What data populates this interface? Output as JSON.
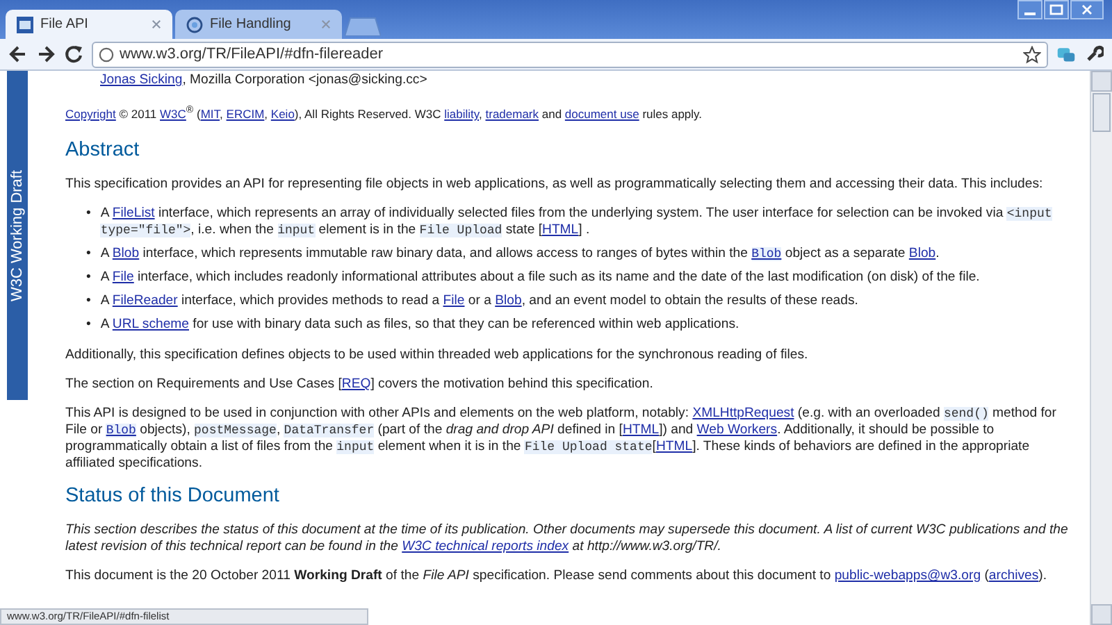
{
  "browser": {
    "tabs": [
      {
        "title": "File API",
        "selected": true
      },
      {
        "title": "File Handling",
        "selected": false
      }
    ],
    "address": "www.w3.org/TR/FileAPI/#dfn-filereader"
  },
  "sidebar_badge": "W3C Working Draft",
  "document": {
    "blocks": [
      {
        "kind": "editor",
        "segments": [
          {
            "kind": "link",
            "text": "Jonas Sicking"
          },
          {
            "kind": "text",
            "text": ", Mozilla Corporation <jonas@sicking.cc>"
          }
        ]
      },
      {
        "kind": "note",
        "segments": [
          {
            "kind": "link",
            "text": "Copyright"
          },
          {
            "kind": "text",
            "text": " © 2011 "
          },
          {
            "kind": "link",
            "text": "W3C"
          },
          {
            "kind": "text",
            "text": "$^{®}$ ("
          },
          {
            "kind": "link",
            "text": "MIT"
          },
          {
            "kind": "text",
            "text": ", "
          },
          {
            "kind": "link",
            "text": "ERCIM"
          },
          {
            "kind": "text",
            "text": ", "
          },
          {
            "kind": "link",
            "text": "Keio"
          },
          {
            "kind": "text",
            "text": "), All Rights Reserved. W3C "
          },
          {
            "kind": "link",
            "text": "liability"
          },
          {
            "kind": "text",
            "text": ", "
          },
          {
            "kind": "link",
            "text": "trademark"
          },
          {
            "kind": "text",
            "text": " and "
          },
          {
            "kind": "link",
            "text": "document use"
          },
          {
            "kind": "text",
            "text": " rules apply."
          }
        ]
      },
      {
        "kind": "heading",
        "text": "Abstract"
      },
      {
        "kind": "para",
        "segments": [
          {
            "kind": "text",
            "text": "This specification provides an API for representing file objects in web applications, as well as programmatically selecting them and accessing their data. This includes:"
          }
        ]
      },
      {
        "kind": "list",
        "items": [
          {
            "marker": "•",
            "segments": [
              {
                "kind": "text",
                "text": "A "
              },
              {
                "kind": "link",
                "text": "FileList"
              },
              {
                "kind": "text",
                "text": " interface, which represents an array of individually selected files from the underlying system. The user interface for selection can be invoked via "
              },
              {
                "kind": "code",
                "text": "<input type=\"file\">"
              },
              {
                "kind": "text",
                "text": ", i.e. when the "
              },
              {
                "kind": "code",
                "text": "input"
              },
              {
                "kind": "text",
                "text": " element is in the "
              },
              {
                "kind": "code",
                "text": "File Upload"
              },
              {
                "kind": "text",
                "text": " state ["
              },
              {
                "kind": "link",
                "text": "HTML"
              },
              {
                "kind": "text",
                "text": "] ."
              }
            ]
          },
          {
            "marker": "•",
            "segments": [
              {
                "kind": "text",
                "text": "A "
              },
              {
                "kind": "link",
                "text": "Blob"
              },
              {
                "kind": "text",
                "text": " interface, which represents immutable raw binary data, and allows access to ranges of bytes within the "
              },
              {
                "kind": "code_link",
                "text": "Blob"
              },
              {
                "kind": "text",
                "text": " object as a separate "
              },
              {
                "kind": "link",
                "text": "Blob"
              },
              {
                "kind": "text",
                "text": "."
              }
            ]
          },
          {
            "marker": "•",
            "segments": [
              {
                "kind": "text",
                "text": "A "
              },
              {
                "kind": "link",
                "text": "File"
              },
              {
                "kind": "text",
                "text": " interface, which includes readonly informational attributes about a file such as its name and the date of the last modification (on disk) of the file."
              }
            ]
          },
          {
            "marker": "•",
            "segments": [
              {
                "kind": "text",
                "text": "A "
              },
              {
                "kind": "link",
                "text": "FileReader"
              },
              {
                "kind": "text",
                "text": " interface, which provides methods to read a "
              },
              {
                "kind": "link",
                "text": "File"
              },
              {
                "kind": "text",
                "text": " or a "
              },
              {
                "kind": "link",
                "text": "Blob"
              },
              {
                "kind": "text",
                "text": ", and an event model to obtain the results of these reads."
              }
            ]
          },
          {
            "marker": "•",
            "segments": [
              {
                "kind": "text",
                "text": "A "
              },
              {
                "kind": "link",
                "text": "URL scheme"
              },
              {
                "kind": "text",
                "text": " for use with binary data such as files, so that they can be referenced within web applications."
              }
            ]
          }
        ]
      },
      {
        "kind": "para",
        "segments": [
          {
            "kind": "text",
            "text": "Additionally, this specification defines objects to be used within threaded web applications for the synchronous reading of files."
          }
        ]
      },
      {
        "kind": "para",
        "segments": [
          {
            "kind": "text",
            "text": "The section on Requirements and Use Cases ["
          },
          {
            "kind": "link",
            "text": "REQ"
          },
          {
            "kind": "text",
            "text": "] covers the motivation behind this specification."
          }
        ]
      },
      {
        "kind": "para",
        "segments": [
          {
            "kind": "text",
            "text": "This API is designed to be used in conjunction with other APIs and elements on the web platform, notably: "
          },
          {
            "kind": "link",
            "text": "XMLHttpRequest"
          },
          {
            "kind": "text",
            "text": " (e.g. with an overloaded "
          },
          {
            "kind": "code",
            "text": "send()"
          },
          {
            "kind": "text",
            "text": " method for File or "
          },
          {
            "kind": "code_link",
            "text": "Blob"
          },
          {
            "kind": "text",
            "text": " objects), "
          },
          {
            "kind": "code",
            "text": "postMessage"
          },
          {
            "kind": "text",
            "text": ", "
          },
          {
            "kind": "code",
            "text": "DataTransfer"
          },
          {
            "kind": "text",
            "text": " (part of the *drag and drop API* defined in ["
          },
          {
            "kind": "link",
            "text": "HTML"
          },
          {
            "kind": "text",
            "text": "]) and "
          },
          {
            "kind": "link",
            "text": "Web Workers"
          },
          {
            "kind": "text",
            "text": ". Additionally, it should be possible to programmatically obtain a list of files from the "
          },
          {
            "kind": "code",
            "text": "input"
          },
          {
            "kind": "text",
            "text": " element when it is in the "
          },
          {
            "kind": "code",
            "text": "File Upload state"
          },
          {
            "kind": "text",
            "text": "["
          },
          {
            "kind": "link",
            "text": "HTML"
          },
          {
            "kind": "text",
            "text": "]. These kinds of behaviors are defined in the appropriate affiliated specifications."
          }
        ]
      },
      {
        "kind": "heading",
        "text": "Status of this Document"
      },
      {
        "kind": "italic_para",
        "segments": [
          {
            "kind": "text",
            "text": "This section describes the status of this document at the time of its publication. Other documents may supersede this document. A list of current W3C publications and the latest revision of this technical report can be found in the "
          },
          {
            "kind": "link",
            "text": "W3C technical reports index"
          },
          {
            "kind": "text",
            "text": " at http://www.w3.org/TR/."
          }
        ]
      },
      {
        "kind": "para",
        "segments": [
          {
            "kind": "text",
            "text": "This document is the 20 October 2011 **Working Draft** of the *File API* specification. Please send comments about this document to "
          },
          {
            "kind": "link",
            "text": "public-webapps@w3.org"
          },
          {
            "kind": "text",
            "text": " ("
          },
          {
            "kind": "link",
            "text": "archives"
          },
          {
            "kind": "text",
            "text": ")."
          }
        ]
      }
    ]
  },
  "status_bar": "www.w3.org/TR/FileAPI/#dfn-filelist"
}
